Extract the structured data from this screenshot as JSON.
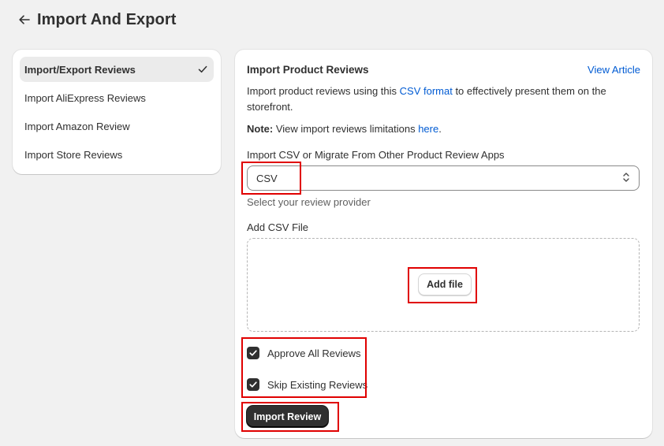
{
  "header": {
    "title": "Import And Export"
  },
  "sidebar": {
    "items": [
      {
        "label": "Import/Export Reviews",
        "active": true
      },
      {
        "label": "Import AliExpress Reviews",
        "active": false
      },
      {
        "label": "Import Amazon Review",
        "active": false
      },
      {
        "label": "Import Store Reviews",
        "active": false
      }
    ]
  },
  "main": {
    "title": "Import Product Reviews",
    "view_article": "View Article",
    "description": {
      "before": "Import product reviews using this ",
      "link": "CSV format",
      "after": " to effectively present them on the storefront."
    },
    "note": {
      "label": "Note:",
      "text": " View import reviews limitations ",
      "link": "here",
      "end": "."
    },
    "provider": {
      "label": "Import CSV or Migrate From Other Product Review Apps",
      "value": "CSV",
      "hint": "Select your review provider"
    },
    "file": {
      "label": "Add CSV File",
      "button": "Add file"
    },
    "options": {
      "approve_all": {
        "label": "Approve All Reviews",
        "checked": true
      },
      "skip_existing": {
        "label": "Skip Existing Reviews",
        "checked": true
      }
    },
    "submit": "Import Review"
  },
  "colors": {
    "background": "#f1f1f1",
    "link": "#005bd3",
    "primary_button": "#303030",
    "highlight": "#e00000"
  },
  "icons": {
    "back": "arrow-left-icon",
    "active_item": "checkmark-icon",
    "select": "select-arrows-icon",
    "checkbox": "checkbox-checked-icon"
  }
}
